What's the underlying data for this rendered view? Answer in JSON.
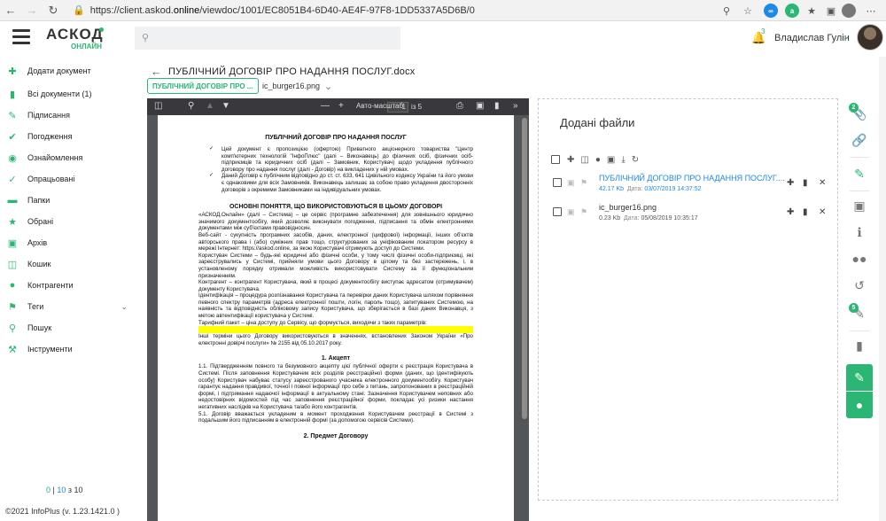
{
  "browser": {
    "url_prefix": "https://client.askod.",
    "url_domain": "online",
    "url_path": "/viewdoc/1001/EC8051B4-6D40-AE4F-97F8-1DD5337A5D6B/0",
    "badge_a": "a"
  },
  "header": {
    "logo": "АСКОД",
    "logo_sub": "ОНЛАЙН",
    "notifications_count": "3",
    "user_name": "Владислав Гулін"
  },
  "sidebar": {
    "items": [
      {
        "label": "Додати документ",
        "icon": "plus-icon"
      },
      {
        "label": "Всі документи (1)",
        "icon": "document-icon"
      },
      {
        "label": "Підписання",
        "icon": "pen-icon"
      },
      {
        "label": "Погодження",
        "icon": "check-icon"
      },
      {
        "label": "Ознайомлення",
        "icon": "eye-icon"
      },
      {
        "label": "Опрацьовані",
        "icon": "check-circle-icon"
      },
      {
        "label": "Папки",
        "icon": "folder-icon"
      },
      {
        "label": "Обрані",
        "icon": "star-icon"
      },
      {
        "label": "Архів",
        "icon": "archive-icon"
      },
      {
        "label": "Кошик",
        "icon": "trash-icon"
      },
      {
        "label": "Контрагенти",
        "icon": "user-icon"
      },
      {
        "label": "Теги",
        "icon": "tag-icon"
      },
      {
        "label": "Пошук",
        "icon": "search-icon"
      },
      {
        "label": "Інструменти",
        "icon": "wrench-icon"
      }
    ],
    "pager": {
      "a": "0",
      "sep": " | ",
      "b": "10",
      "of": " з ",
      "total": "10"
    },
    "version": "©2021 InfoPlus (v. 1.23.1421.0 )"
  },
  "main": {
    "doc_title": "ПУБЛІЧНИЙ ДОГОВІР ПРО НАДАННЯ ПОСЛУГ.docx",
    "tabs": [
      {
        "label": "ПУБЛІЧНИЙ ДОГОВІР ПРО ..."
      },
      {
        "label": "ic_burger16.png"
      }
    ]
  },
  "pdf": {
    "page": "1",
    "of": "із 5",
    "zoom": "Авто-масштаб",
    "title": "ПУБЛІЧНИЙ ДОГОВІР ПРО НАДАННЯ ПОСЛУГ",
    "bullet1": "Цей документ є пропозицією (офертою) Приватного акціонерного товариства \"Центр комп'ютерних технологій \"ІнфоПлюс\" (далі – Виконавець) до фізичних осіб, фізичних осіб-підприємців та юридичних осіб (далі – Замовник, Користувач) щодо укладення публічного договору про надання послуг (далі - Договір) на викладених у ній умовах.",
    "bullet2": "Даний Договір є публічним відповідно до ст. ст. 633, 641 Цивільного кодексу України та його умови є однаковими для всіх Замовників. Виконавець залишає за собою право укладення двосторонніх договорів з окремими Замовниками на індивідуальних умовах.",
    "section1": "ОСНОВНІ ПОНЯТТЯ, ЩО ВИКОРИСТОВУЮТЬСЯ В ЦЬОМУ ДОГОВОРІ",
    "p_askod": "«АСКОД.Онлайн» (далі – Система) – це сервіс (програмне забезпечення) для зовнішнього юридично значимого документообігу, який дозволяє виконувати погодження, підписання та обмін електронними документами між суб'єктами правовідносин.",
    "p_website": "Веб-сайт - сукупність програмних засобів, даних, електронної (цифрової) інформації, інших об'єктів авторського права і (або) суміжних прав тощо, структурованих за уніфікованим локатором ресурсу в мережі Інтернет: https://askod.online, за якою Користувачі отримують доступ до Системи.",
    "p_user": "Користувач Системи – будь-які юридичні або фізичні особи, у тому числі фізичні особи-підприємці, які зареєструвались у Системі, прийняли умови цього Договору в цілому та без застережень, і, в установленому порядку отримали можливість використовувати Систему за її функціональним призначенням.",
    "p_contractor": "Контрагент – контрагент Користувача, який в процесі документообігу виступає адресатом (отримувачем) документу Користувача.",
    "p_ident": "Ідентифікація – процедура розпізнавання Користувача та перевірки даних Користувача шляхом порівняння певного спектру параметрів (адреса електронної пошти, логін, пароль тощо), запитуваних Системою, на наявність та відповідність обліковому запису Користувача, що зберігається в базі даних Виконавця, з метою автентифікації користувача у Системі.",
    "p_tariff": "Тарифний пакет – ціна доступу до Сервісу, що формується, виходячи з таких параметрів:",
    "p_terms": "Інші терміни цього Договору використовуються в значеннях, встановлених Законом України «Про електронні довірчі послуги» № 2155 від 05.10.2017 року.",
    "section2": "1. Акцепт",
    "p_11": "1.1. Підтвердженням повного та безумовного акцепту цієї публічної оферти є реєстрація Користувача в Системі. Після заповнення Користувачем всіх розділів реєстраційної форми (даних, що ідентифікують особу) Користувач набуває статусу зареєстрованого учасника електронного документообігу. Користувач гарантує надання правдивої, точної і повної інформації про себе з питань, запропонованих в реєстраційній формі, і підтримання надаючої інформації в актуальному стані. Зазначення Користувачем неповних або недостовірних відомостей під час заповнення реєстраційної форми, покладає усі ризики настання негативних наслідків на Користувача та/або його контрагентів.",
    "p_51": "5.1. Договір вважається укладеним в момент проходження Користувачем реєстрації в Системі з подальшим його підписанням в електронній формі (за допомогою сервісів Системи).",
    "section3": "2. Предмет Договору"
  },
  "files": {
    "title": "Додані файли",
    "items": [
      {
        "name": "ПУБЛІЧНИЙ ДОГОВІР ПРО НАДАННЯ ПОСЛУГ....",
        "size": "42.17 Kb",
        "date_label": "Дата:",
        "date": "03/07/2019 14:37:52",
        "color": "#1e88e5"
      },
      {
        "name": "ic_burger16.png",
        "size": "0.23 Kb",
        "date_label": "Дата:",
        "date": "05/08/2019 10:35:17",
        "color": "#333333"
      }
    ]
  },
  "rail": {
    "badge_files": "2",
    "badge_comments": "5"
  },
  "colors": {
    "accent": "#2bb673",
    "link": "#1e88e5",
    "highlight": "#ffff00"
  }
}
